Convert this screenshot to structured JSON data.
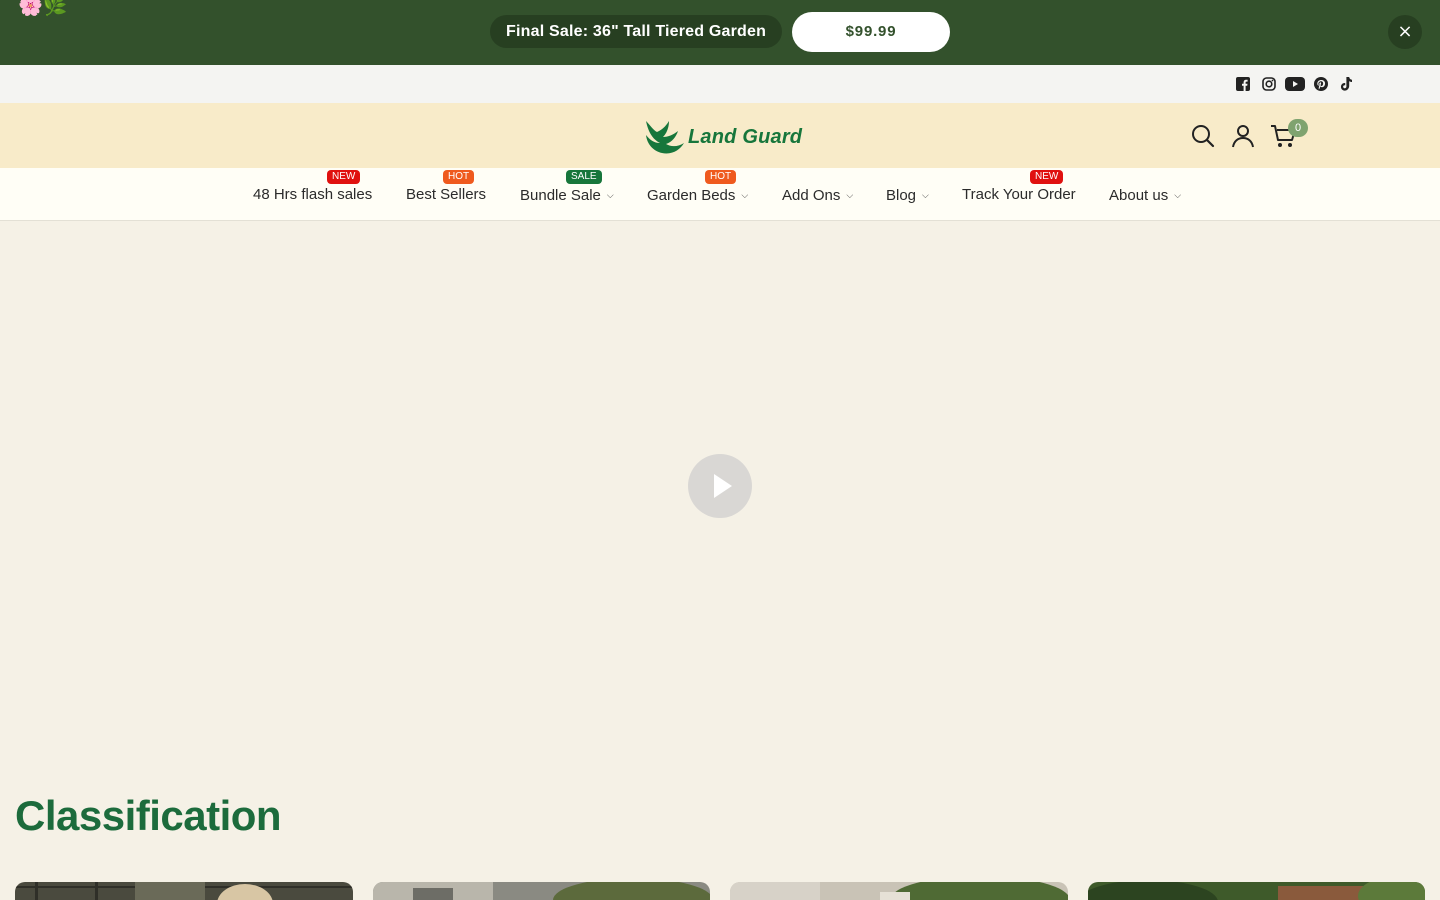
{
  "promo": {
    "emoji": "🌸🌿",
    "title": "Final Sale: 36\" Tall Tiered Garden",
    "price": "$99.99",
    "close_label": "×"
  },
  "social": [
    "facebook-icon",
    "instagram-icon",
    "youtube-icon",
    "pinterest-icon",
    "tiktok-icon"
  ],
  "header": {
    "logo_text": "Land Guard",
    "cart_count": "0",
    "brand_color": "#17763b"
  },
  "nav": {
    "items": [
      {
        "label": "48 Hrs flash sales",
        "badge": "NEW"
      },
      {
        "label": "Best Sellers",
        "badge": "HOT"
      },
      {
        "label": "Bundle Sale",
        "badge": "SALE"
      },
      {
        "label": "Garden Beds",
        "badge": "HOT"
      },
      {
        "label": "Add Ons"
      },
      {
        "label": "Blog"
      },
      {
        "label": "Track Your Order",
        "badge": "NEW"
      },
      {
        "label": "About us"
      }
    ],
    "badge_colors": {
      "NEW": "#e0110f",
      "HOT": "#ef5a1e",
      "SALE": "#17763b"
    }
  },
  "section": {
    "title": "Classification"
  }
}
